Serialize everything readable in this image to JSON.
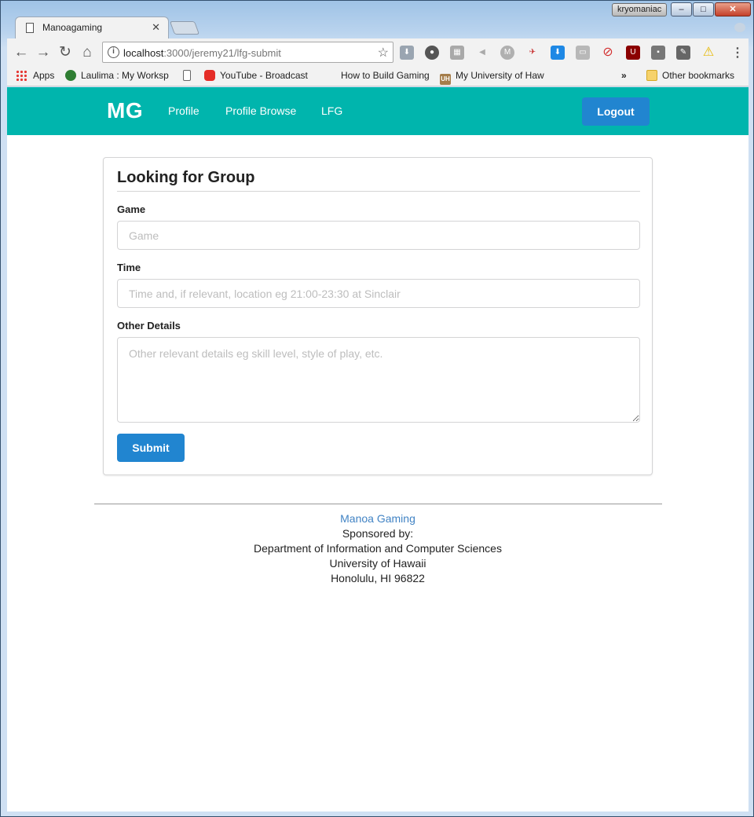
{
  "window": {
    "user": "kryomaniac",
    "min": "–",
    "max": "□",
    "close": "✕"
  },
  "tab": {
    "title": "Manoagaming",
    "close": "✕"
  },
  "toolbar": {
    "back": "←",
    "forward": "→",
    "reload": "↻",
    "home": "⌂",
    "url_host": "localhost",
    "url_path": ":3000/jeremy21/lfg-submit",
    "star": "☆",
    "menu": "⋮"
  },
  "bookmarks": {
    "items": [
      {
        "label": "Apps"
      },
      {
        "label": "Laulima : My Worksp"
      },
      {
        "label": ""
      },
      {
        "label": "YouTube - Broadcast"
      },
      {
        "label": "How to Build Gaming"
      },
      {
        "label": "My University of Haw"
      }
    ],
    "overflow": "»",
    "other": "Other bookmarks",
    "uh_badge": "UH"
  },
  "nav": {
    "brand": "MG",
    "links": [
      "Profile",
      "Profile Browse",
      "LFG"
    ],
    "logout": "Logout"
  },
  "form": {
    "title": "Looking for Group",
    "game_label": "Game",
    "game_placeholder": "Game",
    "time_label": "Time",
    "time_placeholder": "Time and, if relevant, location eg 21:00-23:30 at Sinclair",
    "details_label": "Other Details",
    "details_placeholder": "Other relevant details eg skill level, style of play, etc.",
    "submit": "Submit"
  },
  "footer": {
    "link": "Manoa Gaming",
    "lines": [
      "Sponsored by:",
      "Department of Information and Computer Sciences",
      "University of Hawaii",
      "Honolulu, HI 96822"
    ]
  },
  "colors": {
    "navbar": "#00b5ad",
    "primary_button": "#2185d0",
    "footer_link": "#4183c4"
  }
}
